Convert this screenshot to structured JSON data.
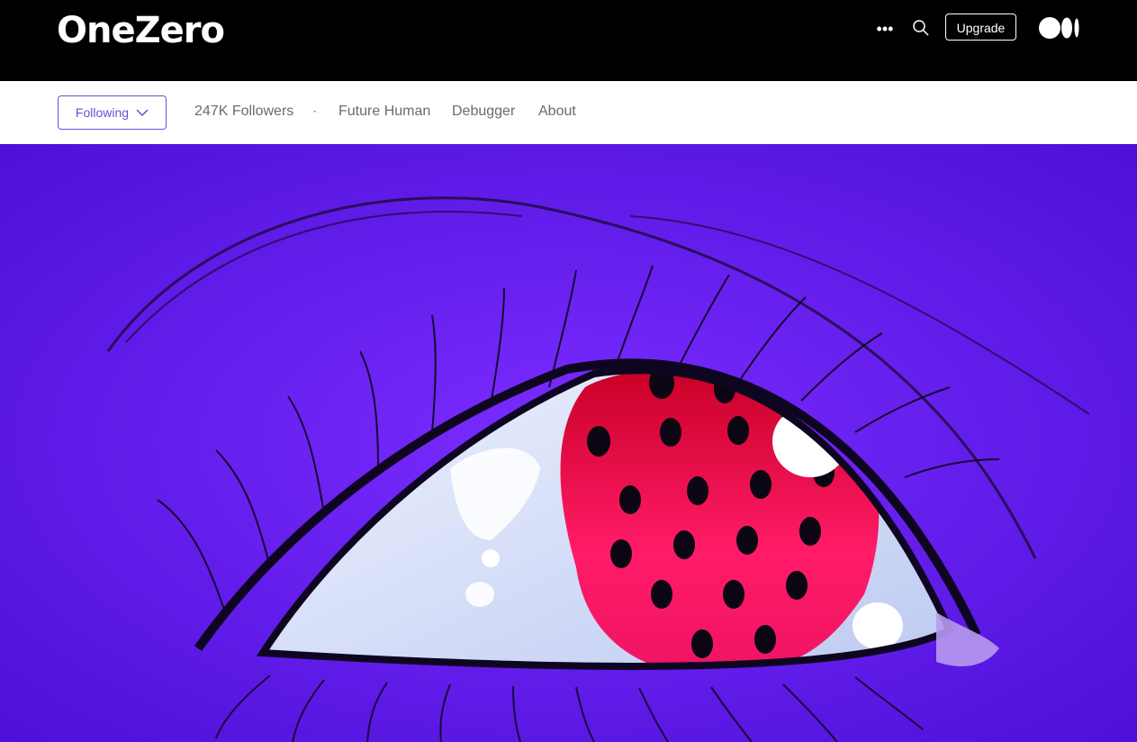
{
  "header": {
    "logo_text": "OneZero",
    "more_label": "•••",
    "upgrade_label": "Upgrade"
  },
  "subnav": {
    "follow_label": "Following",
    "followers": "247K Followers",
    "separator": "·",
    "links": [
      "Future Human",
      "Debugger",
      "About"
    ]
  },
  "hero": {
    "image_semantic": "illustrated close-up of an eye with a red dotted iris on purple background"
  },
  "colors": {
    "header_bg": "#000000",
    "accent": "#6b4fd8",
    "hero_bg": "#6a1cf5",
    "iris_red": "#e8114f",
    "text_muted": "#6b6b6b"
  },
  "icons": [
    "more-icon",
    "search-icon",
    "medium-logo-icon",
    "chevron-down-icon"
  ]
}
